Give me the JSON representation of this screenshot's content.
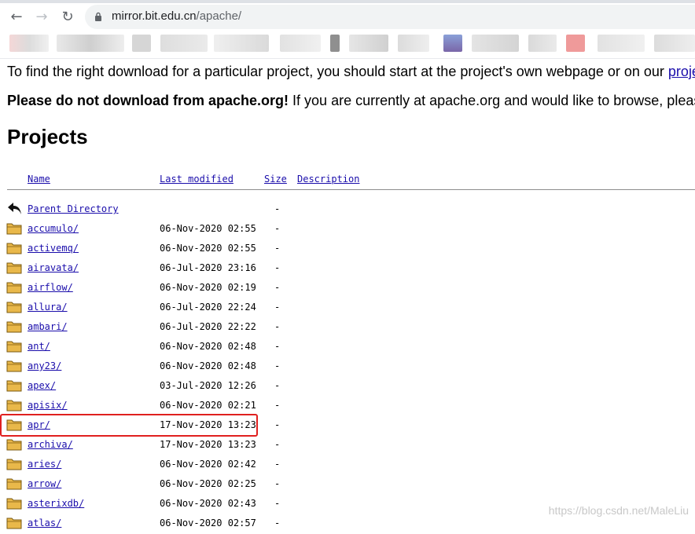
{
  "browser": {
    "url_host": "mirror.bit.edu.cn",
    "url_path": "/apache/"
  },
  "page": {
    "intro_text": "To find the right download for a particular project, you should start at the project's own webpage or on our ",
    "intro_link": "projec",
    "warning_bold": "Please do not download from apache.org!",
    "warning_text": " If you are currently at apache.org and would like to browse, please vis",
    "heading": "Projects"
  },
  "table": {
    "headers": {
      "name": "Name",
      "modified": "Last modified",
      "size": "Size",
      "description": "Description"
    },
    "parent": {
      "name": "Parent Directory",
      "size": "-"
    },
    "rows": [
      {
        "name": "accumulo/",
        "modified": "06-Nov-2020 02:55",
        "size": "-"
      },
      {
        "name": "activemq/",
        "modified": "06-Nov-2020 02:55",
        "size": "-"
      },
      {
        "name": "airavata/",
        "modified": "06-Jul-2020 23:16",
        "size": "-"
      },
      {
        "name": "airflow/",
        "modified": "06-Nov-2020 02:19",
        "size": "-"
      },
      {
        "name": "allura/",
        "modified": "06-Jul-2020 22:24",
        "size": "-"
      },
      {
        "name": "ambari/",
        "modified": "06-Jul-2020 22:22",
        "size": "-"
      },
      {
        "name": "ant/",
        "modified": "06-Nov-2020 02:48",
        "size": "-"
      },
      {
        "name": "any23/",
        "modified": "06-Nov-2020 02:48",
        "size": "-"
      },
      {
        "name": "apex/",
        "modified": "03-Jul-2020 12:26",
        "size": "-"
      },
      {
        "name": "apisix/",
        "modified": "06-Nov-2020 02:21",
        "size": "-"
      },
      {
        "name": "apr/",
        "modified": "17-Nov-2020 13:23",
        "size": "-"
      },
      {
        "name": "archiva/",
        "modified": "17-Nov-2020 13:23",
        "size": "-"
      },
      {
        "name": "aries/",
        "modified": "06-Nov-2020 02:42",
        "size": "-"
      },
      {
        "name": "arrow/",
        "modified": "06-Nov-2020 02:25",
        "size": "-"
      },
      {
        "name": "asterixdb/",
        "modified": "06-Nov-2020 02:43",
        "size": "-"
      },
      {
        "name": "atlas/",
        "modified": "06-Nov-2020 02:57",
        "size": "-"
      }
    ]
  },
  "watermark": "https://blog.csdn.net/MaleLiu",
  "colors": {
    "link": "#1a0dab",
    "highlight": "#e0201f",
    "folder": "#e9b84a"
  }
}
